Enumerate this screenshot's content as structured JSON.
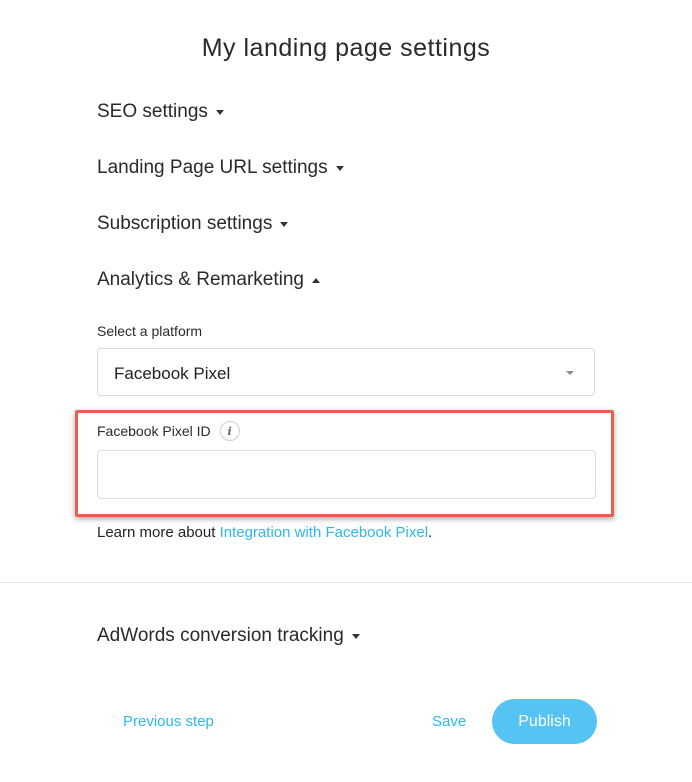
{
  "page": {
    "title": "My landing page settings"
  },
  "sections": {
    "seo": "SEO settings",
    "landing_url": "Landing Page URL settings",
    "subscription": "Subscription settings",
    "analytics": "Analytics & Remarketing",
    "adwords": "AdWords conversion tracking"
  },
  "analytics": {
    "platform_label": "Select a platform",
    "platform_selected": "Facebook Pixel",
    "pixel_id_label": "Facebook Pixel ID",
    "pixel_id_value": "",
    "info_icon_glyph": "i",
    "learn_more_prefix": "Learn more about ",
    "learn_more_link": "Integration with Facebook Pixel",
    "learn_more_suffix": "."
  },
  "footer": {
    "previous_label": "Previous step",
    "save_label": "Save",
    "publish_label": "Publish"
  },
  "colors": {
    "accent": "#2fb8ea",
    "publish_bg": "#55c4f3",
    "highlight_border": "#e8604f"
  }
}
